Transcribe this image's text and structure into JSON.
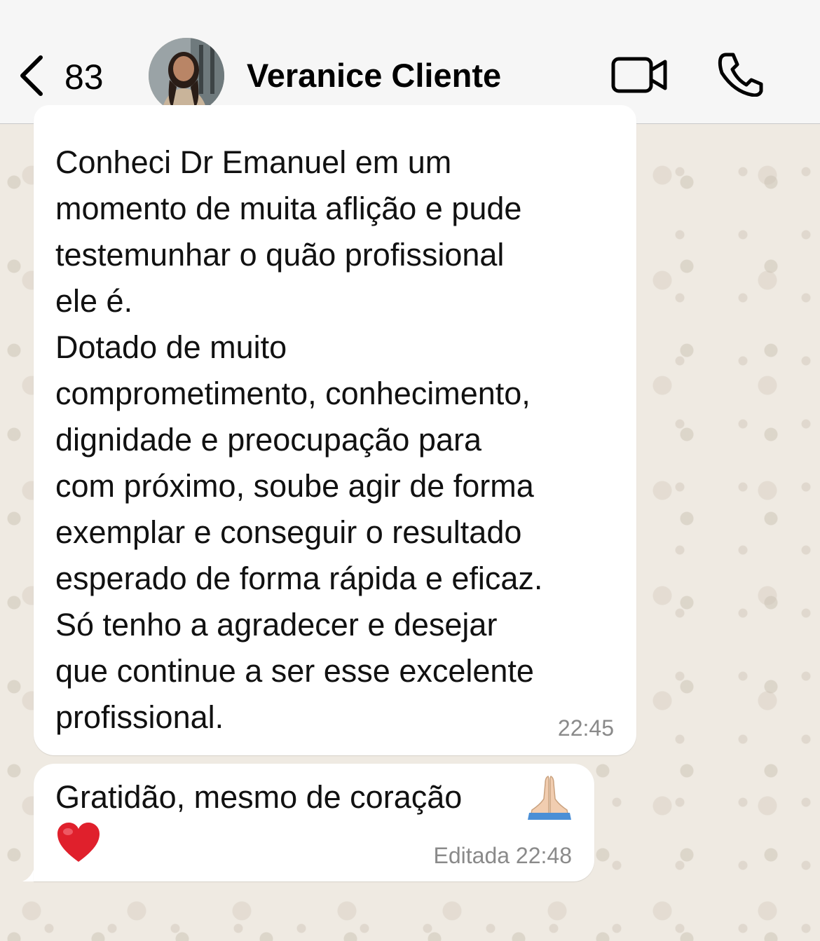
{
  "header": {
    "back_count": "83",
    "contact_name": "Veranice Cliente",
    "back_icon": "chevron-left-icon",
    "video_icon": "video-camera-icon",
    "call_icon": "phone-icon"
  },
  "messages": [
    {
      "text": "Conheci  Dr Emanuel em um\nmomento de muita aflição e pude\ntestemunhar o quão profissional\nele é.\nDotado de muito\ncomprometimento, conhecimento,\ndignidade e preocupação para\ncom próximo, soube agir de forma\nexemplar e conseguir o resultado\nesperado de forma rápida e eficaz.\nSó tenho a agradecer e desejar\nque continue a ser esse excelente\nprofissional.",
      "time": "22:45"
    },
    {
      "text": "Gratidão, mesmo de coração",
      "emojis": [
        "folded-hands",
        "red-heart"
      ],
      "time": "Editada 22:48"
    }
  ],
  "colors": {
    "header_bg": "#f6f6f6",
    "chat_bg": "#efeae2",
    "bubble_bg": "#ffffff",
    "timestamp": "#8a8a8a"
  }
}
